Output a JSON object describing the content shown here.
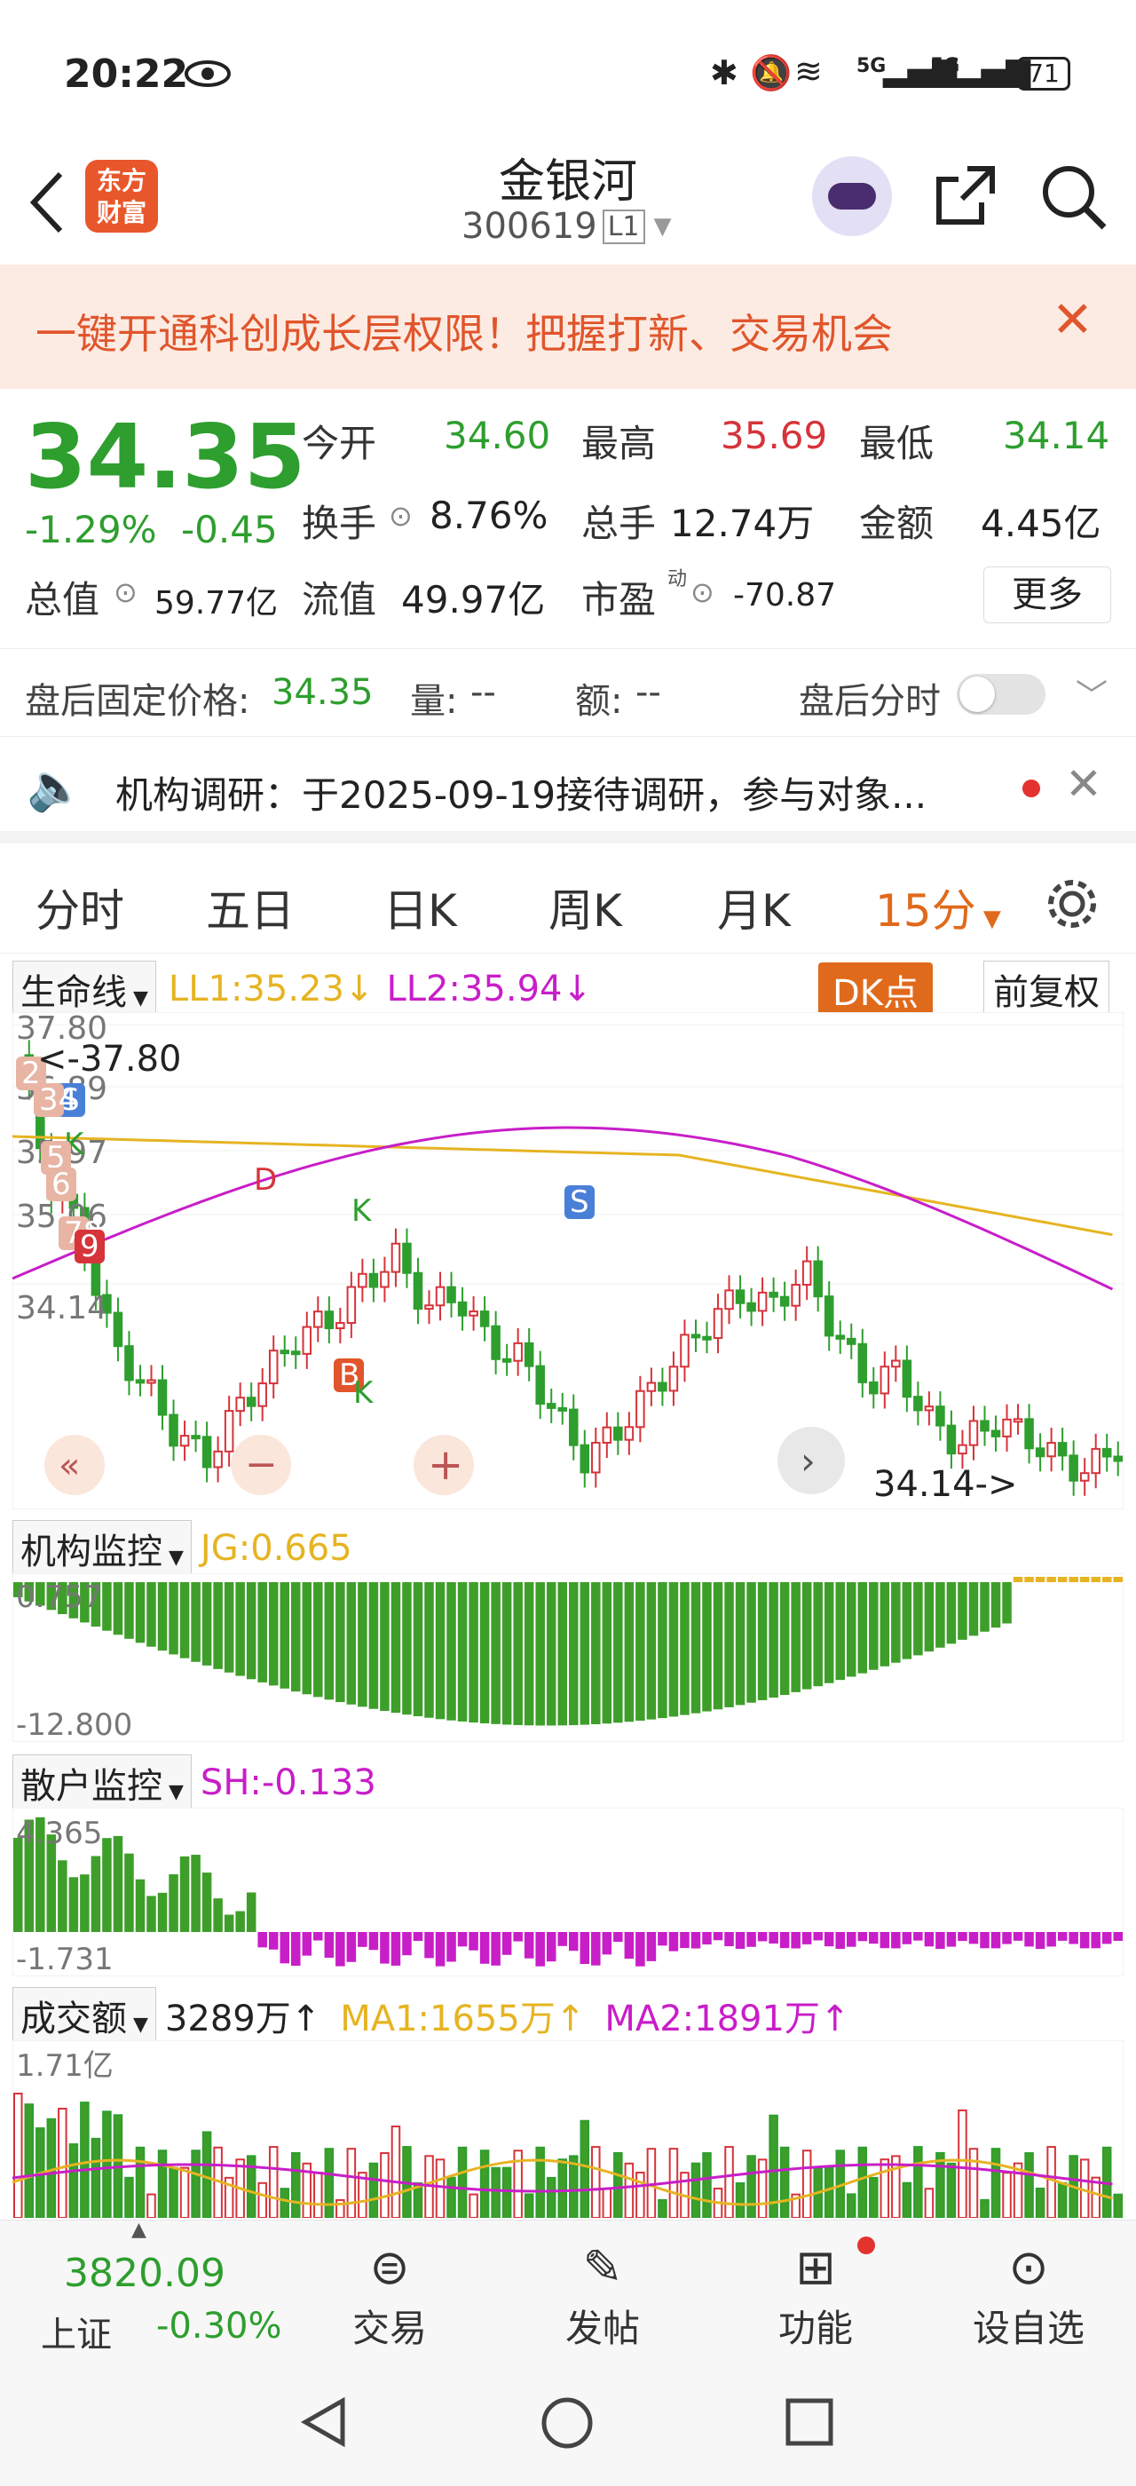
{
  "status": {
    "time": "20:22",
    "battery": "71",
    "signal1": "5G",
    "signal2": "5G"
  },
  "header": {
    "title": "金银河",
    "code": "300619",
    "level": "L1",
    "logo_line1": "东方",
    "logo_line2": "财富"
  },
  "banner": {
    "text": "一键开通科创成长层权限！把握打新、交易机会"
  },
  "quote": {
    "price": "34.35",
    "change_pct": "-1.29%",
    "change": "-0.45",
    "open_label": "今开",
    "open": "34.60",
    "high_label": "最高",
    "high": "35.69",
    "low_label": "最低",
    "low": "34.14",
    "turnover_label": "换手",
    "turnover": "8.76%",
    "vol_label": "总手",
    "vol": "12.74万",
    "amount_label": "金额",
    "amount": "4.45亿",
    "mcap_label": "总值",
    "mcap": "59.77亿",
    "float_label": "流值",
    "float": "49.97亿",
    "pe_label": "市盈",
    "pe_sup": "动",
    "pe": "-70.87",
    "more": "更多"
  },
  "after": {
    "price_label": "盘后固定价格:",
    "price": "34.35",
    "vol_label": "量:",
    "vol": "--",
    "amt_label": "额:",
    "amt": "--",
    "toggle_label": "盘后分时"
  },
  "notice": {
    "text": "机构调研：于2025-09-19接待调研，参与对象..."
  },
  "tabs": [
    "分时",
    "五日",
    "日K",
    "周K",
    "月K",
    "15分"
  ],
  "main": {
    "indicator": "生命线",
    "ll1": "LL1:35.23↓",
    "ll2": "LL2:35.94↓",
    "dk": "DK点",
    "adj": "前复权",
    "y_labels": [
      "37.80",
      "36.89",
      "35.97",
      "35.06",
      "34.14"
    ],
    "max_note": "<-37.80",
    "min_note": "34.14->",
    "markers": [
      "S",
      "K",
      "D",
      "K",
      "B",
      "K",
      "S",
      "2",
      "34",
      "5",
      "6",
      "78",
      "9"
    ]
  },
  "jg": {
    "label": "机构监控",
    "value": "JG:0.665",
    "top": "0.757",
    "bottom": "-12.800"
  },
  "sh": {
    "label": "散户监控",
    "value": "SH:-0.133",
    "top": "4.365",
    "bottom": "-1.731"
  },
  "volume": {
    "label": "成交额",
    "value": "3289万↑",
    "ma1": "MA1:1655万↑",
    "ma2": "MA2:1891万↑",
    "top": "1.71亿"
  },
  "bottomnav": {
    "index_val": "3820.09",
    "index_name": "上证",
    "index_pct": "-0.30%",
    "items": [
      "交易",
      "发帖",
      "功能",
      "设自选"
    ]
  },
  "colors": {
    "up": "#d6333a",
    "down": "#2e9e2e",
    "ll1": "#e6b422",
    "ll2": "#c81ec8",
    "accent": "#e06a1b"
  }
}
